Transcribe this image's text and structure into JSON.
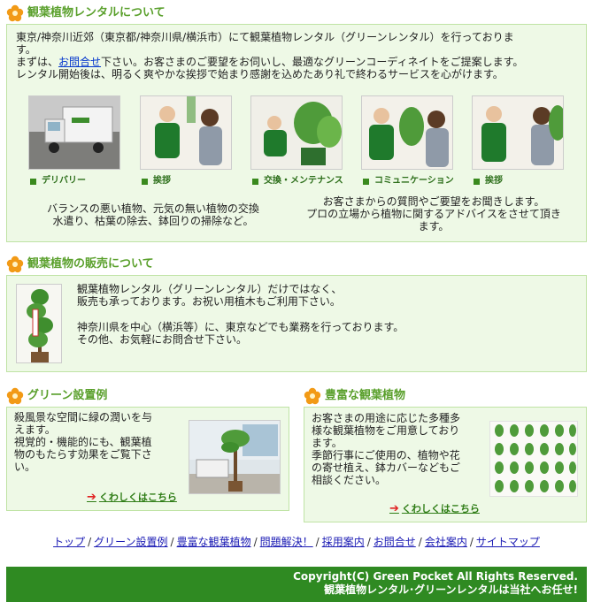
{
  "section_rental": {
    "heading": "観葉植物レンタルについて",
    "para_line1": "東京/神奈川近郊（東京都/神奈川県/横浜市）にて観葉植物レンタル（グリーンレンタル）を行っておりま",
    "para_line2": "す。",
    "para_line3_pre": "まずは、",
    "para_line3_link": "お問合せ",
    "para_line3_post": "下さい。お客さまのご要望をお伺いし、最適なグリーンコーディネイトをご提案します。",
    "para_line4": "レンタル開始後は、明るく爽やかな挨拶で始まり感謝を込めたあり礼で終わるサービスを心がけます。",
    "captions": [
      "デリバリー",
      "挨拶",
      "交換・メンテナンス",
      "コミュニケーション",
      "挨拶"
    ],
    "left_note_line1": "バランスの悪い植物、元気の無い植物の交換",
    "left_note_line2": "水遣り、枯葉の除去、鉢回りの掃除など。",
    "right_note_line1": "お客さまからの質問やご要望をお聞きします。",
    "right_note_line2": "プロの立場から植物に関するアドバイスをさせて頂き",
    "right_note_line3": "ます。"
  },
  "section_sales": {
    "heading": "観葉植物の販売について",
    "line1": "観葉植物レンタル（グリーンレンタル）だけではなく、",
    "line2": "販売も承っております。お祝い用植木もご利用下さい。",
    "line3": "神奈川県を中心（横浜等）に、東京などでも業務を行っております。",
    "line4": "その他、お気軽にお問合せ下さい。"
  },
  "section_green": {
    "heading": "グリーン設置例",
    "line1": "殺風景な空間に緑の潤いを与",
    "line2": "えます。",
    "line3": "視覚的・機能的にも、観葉植",
    "line4": "物のもたらす効果をご覧下さ",
    "line5": "い。",
    "more": "くわしくはこちら"
  },
  "section_plants": {
    "heading": "豊富な観葉植物",
    "line1": "お客さまの用途に応じた多種多",
    "line2": "様な観葉植物をご用意しており",
    "line3": "ます。",
    "line4": "季節行事にご使用の、植物や花",
    "line5": "の寄せ植え、鉢カバーなどもご",
    "line6": "相談ください。",
    "more": "くわしくはこちら"
  },
  "footer_nav": [
    "トップ",
    "グリーン設置例",
    "豊富な観葉植物",
    "問題解決！",
    "採用案内",
    "お問合せ",
    "会社案内",
    "サイトマップ"
  ],
  "footer": {
    "copyright": "Copyright(C) Green Pocket All Rights Reserved.",
    "tagline": "観葉植物レンタル･グリーンレンタルは当社へお任せ!"
  },
  "colors": {
    "accent_green": "#5aa02c",
    "box_bg": "#eef9e6",
    "footer_bg": "#2f8a22",
    "link_blue": "#0033cc"
  }
}
